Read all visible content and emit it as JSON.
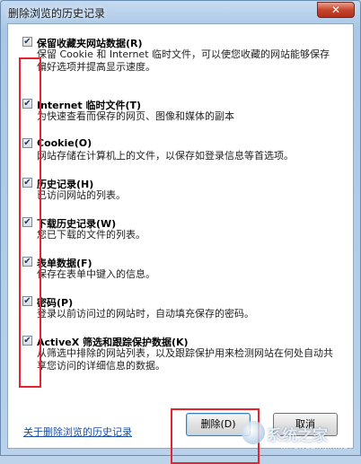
{
  "window": {
    "title": "删除浏览的历史记录",
    "close_label": "✕"
  },
  "items": [
    {
      "label": "保留收藏夹网站数据(R)",
      "desc": "保留 Cookie 和 Internet 临时文件，可以使您收藏的网站能够保存偏好选项并提高显示速度。",
      "checked": true
    },
    {
      "label": "Internet 临时文件(T)",
      "desc": "为快速查看而保存的网页、图像和媒体的副本",
      "checked": true
    },
    {
      "label": "Cookie(O)",
      "desc": "网站存储在计算机上的文件，以保存如登录信息等首选项。",
      "checked": true
    },
    {
      "label": "历史记录(H)",
      "desc": "已访问网站的列表。",
      "checked": true
    },
    {
      "label": "下载历史记录(W)",
      "desc": "您已下载的文件的列表。",
      "checked": true
    },
    {
      "label": "表单数据(F)",
      "desc": "保存在表单中键入的信息。",
      "checked": true
    },
    {
      "label": "密码(P)",
      "desc": "登录以前访问过的网站时，自动填充保存的密码。",
      "checked": true
    },
    {
      "label": "ActiveX 筛选和跟踪保护数据(K)",
      "desc": "从筛选中排除的网站列表，以及跟踪保护用来检测网站在何处自动共享您访问的详细信息的数据。",
      "checked": true
    }
  ],
  "footer": {
    "link": "关于删除浏览的历史记录",
    "delete_label": "删除(D)",
    "cancel_label": "取消"
  },
  "watermark": {
    "main": "系统之家",
    "sub": "XITONGZHIJIA.NET"
  }
}
